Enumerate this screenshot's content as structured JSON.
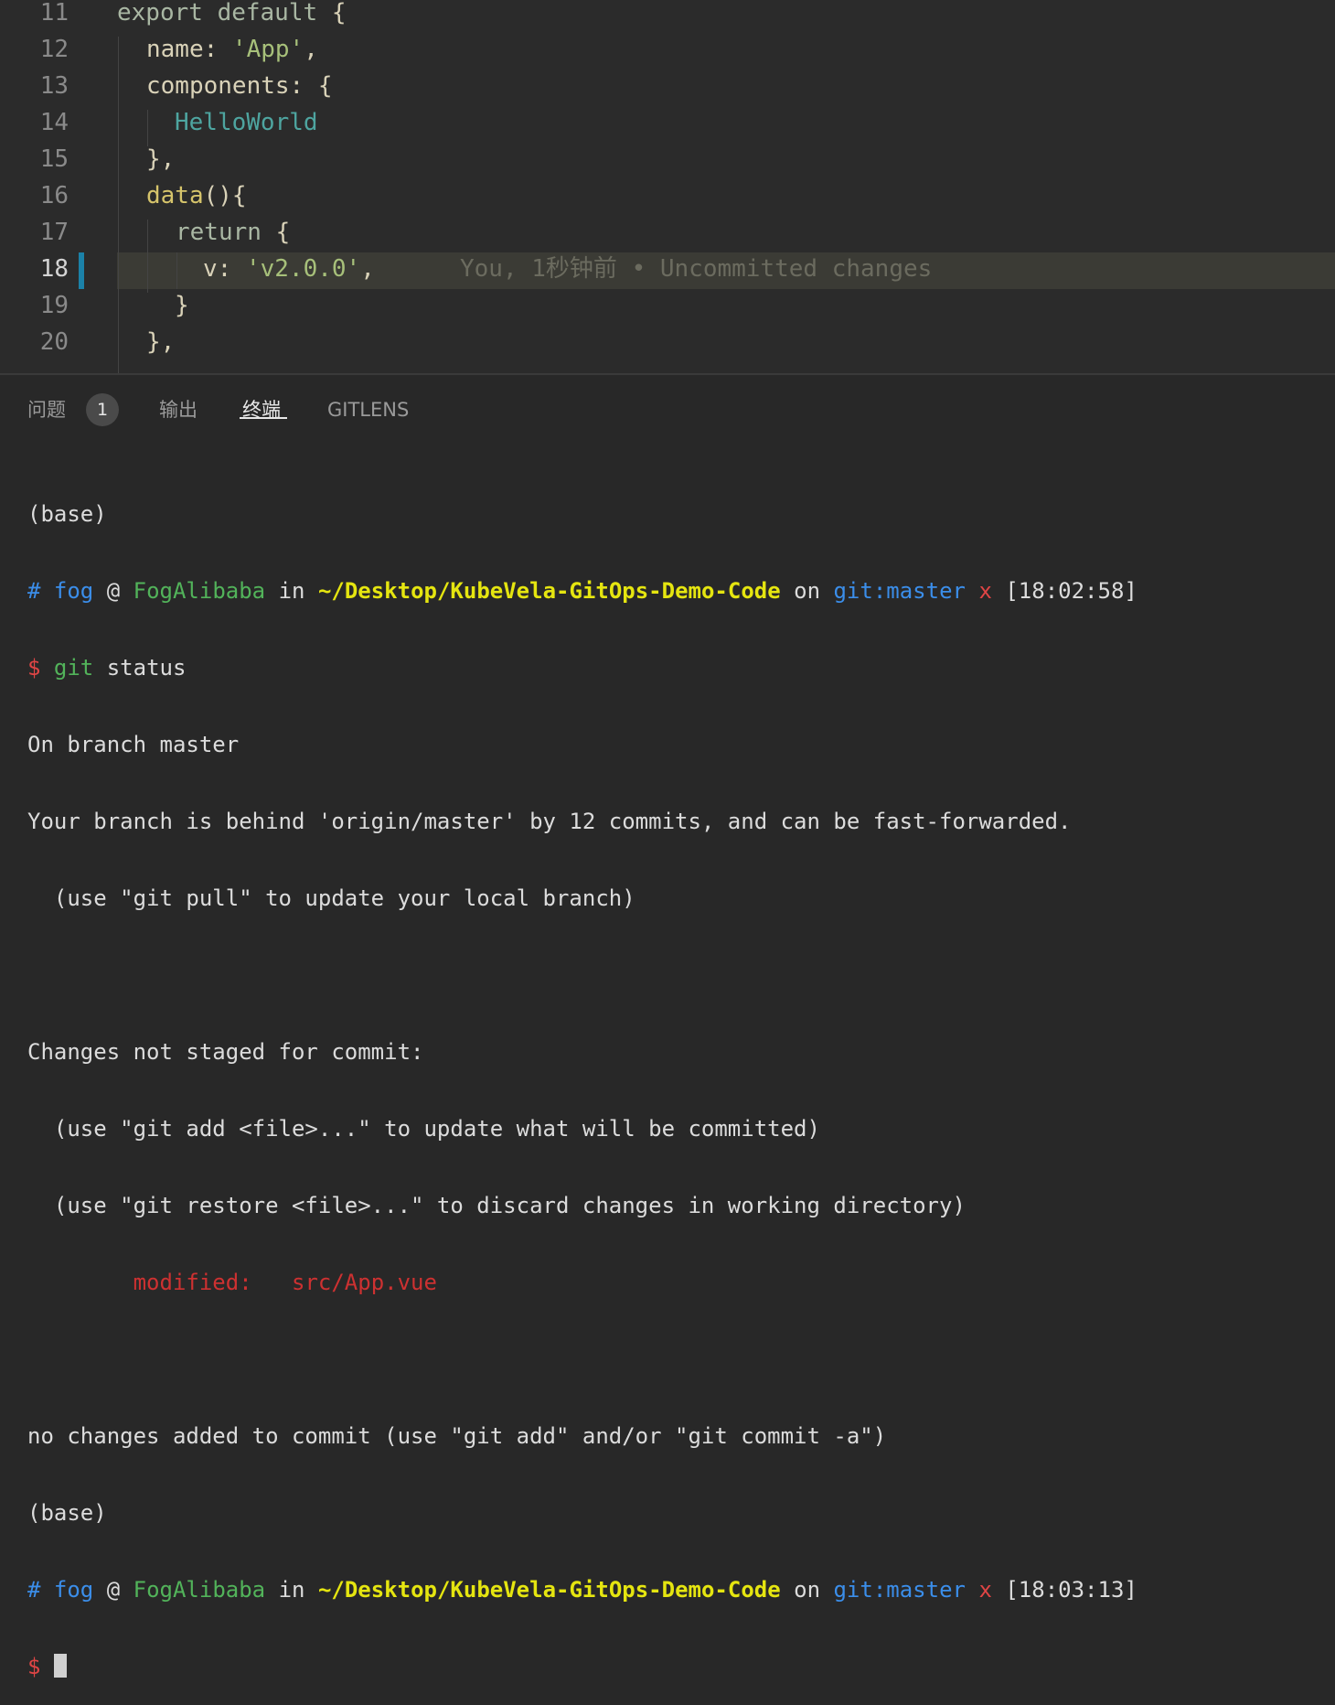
{
  "editor": {
    "lines": [
      {
        "num": "11"
      },
      {
        "num": "12"
      },
      {
        "num": "13"
      },
      {
        "num": "14"
      },
      {
        "num": "15"
      },
      {
        "num": "16"
      },
      {
        "num": "17"
      },
      {
        "num": "18"
      },
      {
        "num": "19"
      },
      {
        "num": "20"
      }
    ],
    "code": {
      "l11_a": "export default ",
      "l11_b": "{",
      "l12_a": "name: ",
      "l12_b": "'App'",
      "l12_c": ",",
      "l13_a": "components: ",
      "l13_b": "{",
      "l14": "HelloWorld",
      "l15": "},",
      "l16_a": "data",
      "l16_b": "(){",
      "l17_a": "return ",
      "l17_b": "{",
      "l18_a": "v: ",
      "l18_b": "'v2.0.0'",
      "l18_c": ",",
      "l19": "}",
      "l20": "},"
    },
    "blame": "You, 1秒钟前 • Uncommitted changes"
  },
  "panel": {
    "tabs": [
      {
        "label": "问题"
      },
      {
        "label": "输出"
      },
      {
        "label": "终端"
      },
      {
        "label": "GITLENS"
      }
    ],
    "problems_count": "1"
  },
  "terminal": {
    "base": "(base)",
    "prompt_hash": "#",
    "user": "fog",
    "at": "@",
    "host": "FogAlibaba",
    "in": "in",
    "path": "~/Desktop/KubeVela-GitOps-Demo-Code",
    "on": "on",
    "git_label": "git:",
    "branch": "master",
    "dirty": "x",
    "time1": "[18:02:58]",
    "time2": "[18:03:13]",
    "dollar": "$",
    "cmd": "git",
    "cmd_arg": "status",
    "out1": "On branch master",
    "out2": "Your branch is behind 'origin/master' by 12 commits, and can be fast-forwarded.",
    "out3": "  (use \"git pull\" to update your local branch)",
    "out4": "Changes not staged for commit:",
    "out5": "  (use \"git add <file>...\" to update what will be committed)",
    "out6": "  (use \"git restore <file>...\" to discard changes in working directory)",
    "mod_label": "modified:",
    "mod_file": "src/App.vue",
    "out7": "no changes added to commit (use \"git add\" and/or \"git commit -a\")"
  }
}
